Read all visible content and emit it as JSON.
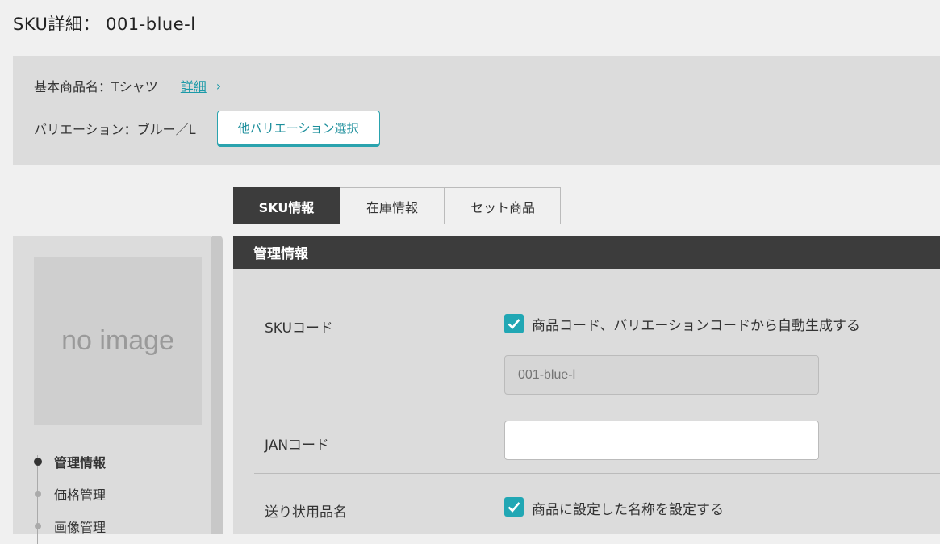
{
  "page": {
    "title": "SKU詳細： 001-blue-l"
  },
  "info": {
    "base_product_label": "基本商品名：Tシャツ",
    "detail_link": "詳細",
    "variation_label": "バリエーション：ブルー／L",
    "other_variation_button": "他バリエーション選択"
  },
  "tabs": [
    {
      "label": "SKU情報",
      "active": true
    },
    {
      "label": "在庫情報",
      "active": false
    },
    {
      "label": "セット商品",
      "active": false
    }
  ],
  "sidebar": {
    "image_placeholder": "no image",
    "nav": [
      {
        "label": "管理情報",
        "active": true
      },
      {
        "label": "価格管理",
        "active": false
      },
      {
        "label": "画像管理",
        "active": false
      }
    ]
  },
  "section": {
    "title": "管理情報",
    "sku_code": {
      "label": "SKUコード",
      "checkbox_label": "商品コード、バリエーションコードから自動生成する",
      "checked": true,
      "input_placeholder": "001-blue-l"
    },
    "jan_code": {
      "label": "JANコード",
      "input_value": ""
    },
    "shipping_name": {
      "label": "送り状用品名",
      "checkbox_label": "商品に設定した名称を設定する",
      "checked": true
    }
  },
  "colors": {
    "accent": "#21a7b4",
    "dark_header": "#3c3c3c"
  }
}
